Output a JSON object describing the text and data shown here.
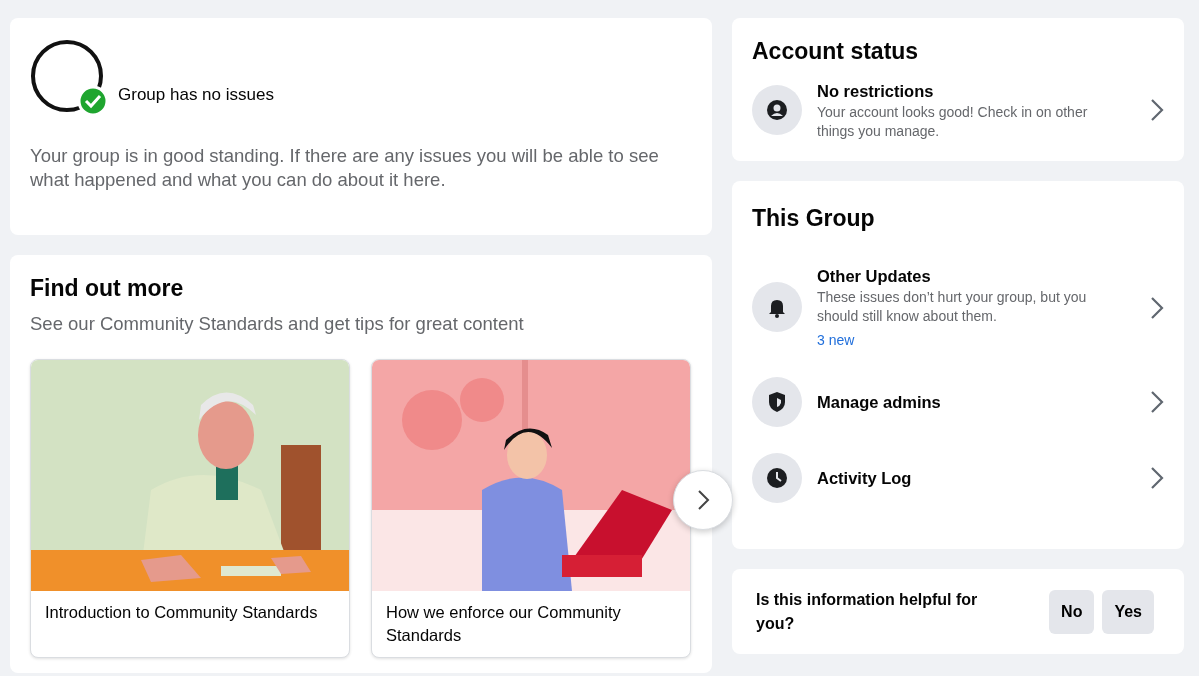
{
  "group": {
    "status": "Group has no issues",
    "description": "Your group is in good standing. If there are any issues you will be able to see what happened and what you can do about it here."
  },
  "find_out_more": {
    "title": "Find out more",
    "subtitle": "See our Community Standards and get tips for great content",
    "articles": [
      {
        "caption": "Introduction to Community Standards"
      },
      {
        "caption": "How we enforce our Community Standards"
      }
    ]
  },
  "account_status": {
    "title": "Account status",
    "items": [
      {
        "title": "No restrictions",
        "description": "Your account looks good! Check in on other things you manage."
      }
    ]
  },
  "this_group": {
    "title": "This Group",
    "items": [
      {
        "title": "Other Updates",
        "description": "These issues don’t hurt your group, but you should still know about them.",
        "badge": "3 new"
      },
      {
        "title": "Manage admins"
      },
      {
        "title": "Activity Log"
      }
    ]
  },
  "feedback": {
    "question": "Is this information helpful for you?",
    "buttons": [
      "No",
      "Yes"
    ]
  }
}
